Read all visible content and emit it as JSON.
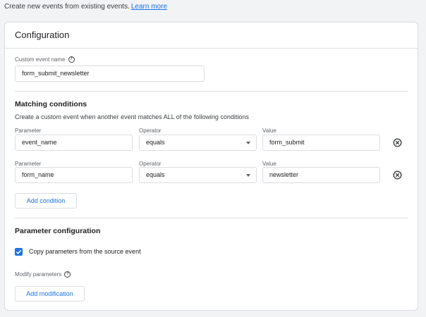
{
  "intro": {
    "text": "Create new events from existing events.",
    "link": "Learn more"
  },
  "card": {
    "title": "Configuration",
    "custom_event_name_label": "Custom event name",
    "custom_event_name_value": "form_submit_newsletter"
  },
  "matching": {
    "title": "Matching conditions",
    "description": "Create a custom event when another event matches ALL of the following conditions",
    "column_labels": {
      "parameter": "Parameter",
      "operator": "Operator",
      "value": "Value"
    },
    "conditions": [
      {
        "parameter": "event_name",
        "operator": "equals",
        "value": "form_submit"
      },
      {
        "parameter": "form_name",
        "operator": "equals",
        "value": "newsletter"
      }
    ],
    "add_condition_label": "Add condition"
  },
  "param_config": {
    "title": "Parameter configuration",
    "copy_label": "Copy parameters from the source event",
    "copy_checked": true,
    "modify_label": "Modify parameters",
    "add_modification_label": "Add modification"
  },
  "colors": {
    "accent": "#1a73e8",
    "border": "#dadce0",
    "background": "#f1f3f4"
  },
  "icons": {
    "help": "help-circle-icon",
    "remove": "remove-circle-icon",
    "dropdown": "chevron-down-icon",
    "check": "check-icon"
  }
}
